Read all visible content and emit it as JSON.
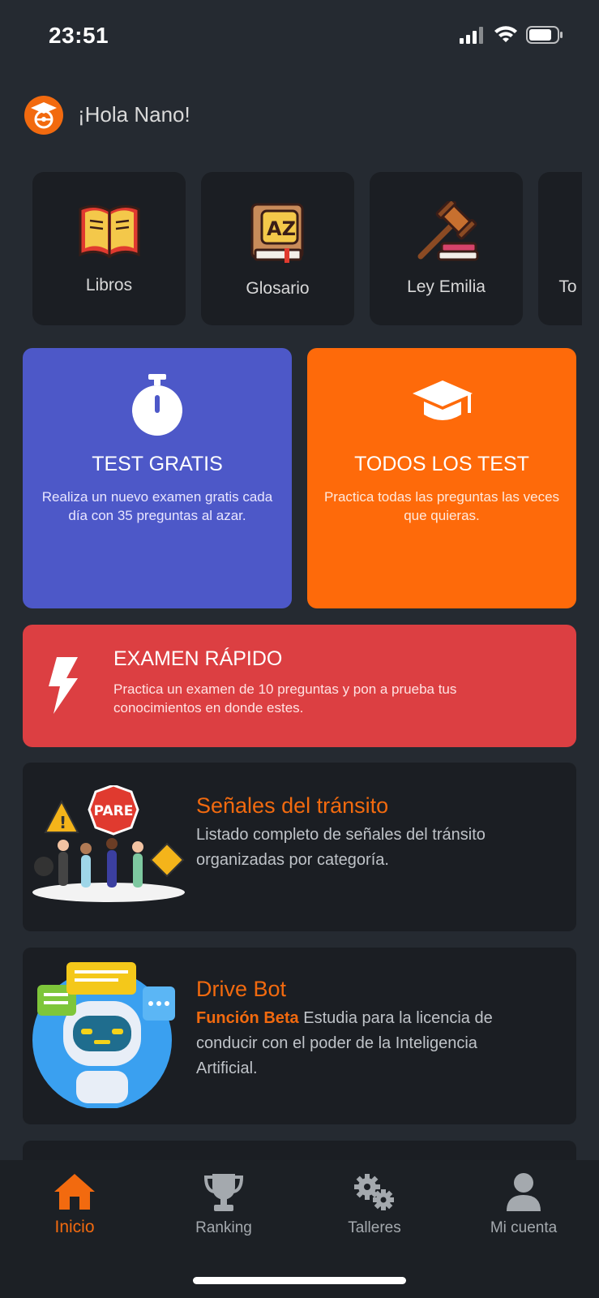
{
  "status_bar": {
    "time": "23:51"
  },
  "greeting": {
    "text": "¡Hola Nano!"
  },
  "tiles": [
    {
      "label": "Libros",
      "icon": "book-icon"
    },
    {
      "label": "Glosario",
      "icon": "glossary-book-icon"
    },
    {
      "label": "Ley Emilia",
      "icon": "gavel-icon"
    },
    {
      "label": "To",
      "icon": "more-icon"
    }
  ],
  "cards": {
    "test_gratis": {
      "title": "TEST GRATIS",
      "description": "Realiza un nuevo examen gratis cada día con 35 preguntas al azar.",
      "color": "#4d58c8"
    },
    "todos_los_test": {
      "title": "TODOS LOS TEST",
      "description": "Practica todas las preguntas las veces que quieras.",
      "color": "#fe6a0a"
    },
    "examen_rapido": {
      "title": "EXAMEN RÁPIDO",
      "description": "Practica un examen de 10 preguntas y pon a prueba tus conocimientos en donde estes.",
      "color": "#dc3f42"
    }
  },
  "list": [
    {
      "title": "Señales del tránsito",
      "description": "Listado completo de señales del tránsito organizadas por categoría.",
      "sign_text": "PARE"
    },
    {
      "title": "Drive Bot",
      "highlight": "Función Beta",
      "description": " Estudia para la licencia de conducir con el poder de la Inteligencia Artificial."
    }
  ],
  "bottom_nav": [
    {
      "label": "Inicio",
      "icon": "home-icon",
      "active": true
    },
    {
      "label": "Ranking",
      "icon": "trophy-icon",
      "active": false
    },
    {
      "label": "Talleres",
      "icon": "gears-icon",
      "active": false
    },
    {
      "label": "Mi cuenta",
      "icon": "user-icon",
      "active": false
    }
  ],
  "colors": {
    "accent": "#f26a0f",
    "background": "#252a31",
    "card": "#1b1e23"
  }
}
